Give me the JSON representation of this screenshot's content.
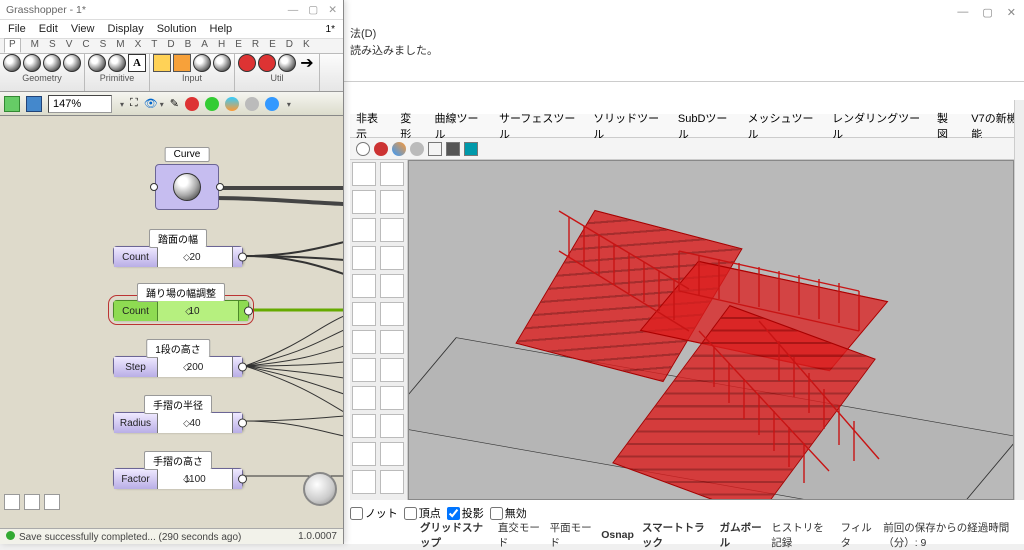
{
  "rhino": {
    "menu_last": "法(D)",
    "status_line": "読み込みました。",
    "tabs": [
      "非表示",
      "変形",
      "曲線ツール",
      "サーフェスツール",
      "ソリッドツール",
      "SubDツール",
      "メッシュツール",
      "レンダリングツール",
      "製図",
      "V7の新機能"
    ],
    "bottom": {
      "nott": "ノット",
      "vertex": "頂点",
      "project": "投影",
      "disable": "無効"
    },
    "footer": [
      "グリッドスナップ",
      "直交モード",
      "平面モード",
      "Osnap",
      "スマートトラック",
      "ガムボール",
      "ヒストリを記録",
      "フィルタ",
      "前回の保存からの経過時間（分）: 9"
    ]
  },
  "gh": {
    "title": "Grasshopper - 1*",
    "dirty": "1*",
    "menu": [
      "File",
      "Edit",
      "View",
      "Display",
      "Solution",
      "Help"
    ],
    "tabletters": [
      "P",
      "M",
      "S",
      "V",
      "C",
      "S",
      "M",
      "X",
      "T",
      "D",
      "B",
      "A",
      "H",
      "E",
      "R",
      "E",
      "D",
      "K"
    ],
    "ribbon_groups": [
      "Geometry",
      "Primitive",
      "Input",
      "Util"
    ],
    "zoom": "147%",
    "footer_msg": "Save successfully completed... (290 seconds ago)",
    "version": "1.0.0007",
    "canvas": {
      "curve": {
        "label": "Curve"
      },
      "sliders": [
        {
          "title": "踏面の幅",
          "cap": "Count",
          "val": "20"
        },
        {
          "title": "踊り場の幅調整",
          "cap": "Count",
          "val": "10",
          "green": true,
          "selected": true
        },
        {
          "title": "1段の高さ",
          "cap": "Step",
          "val": "200"
        },
        {
          "title": "手摺の半径",
          "cap": "Radius",
          "val": "40"
        },
        {
          "title": "手摺の高さ",
          "cap": "Factor",
          "val": "1100"
        }
      ]
    }
  }
}
